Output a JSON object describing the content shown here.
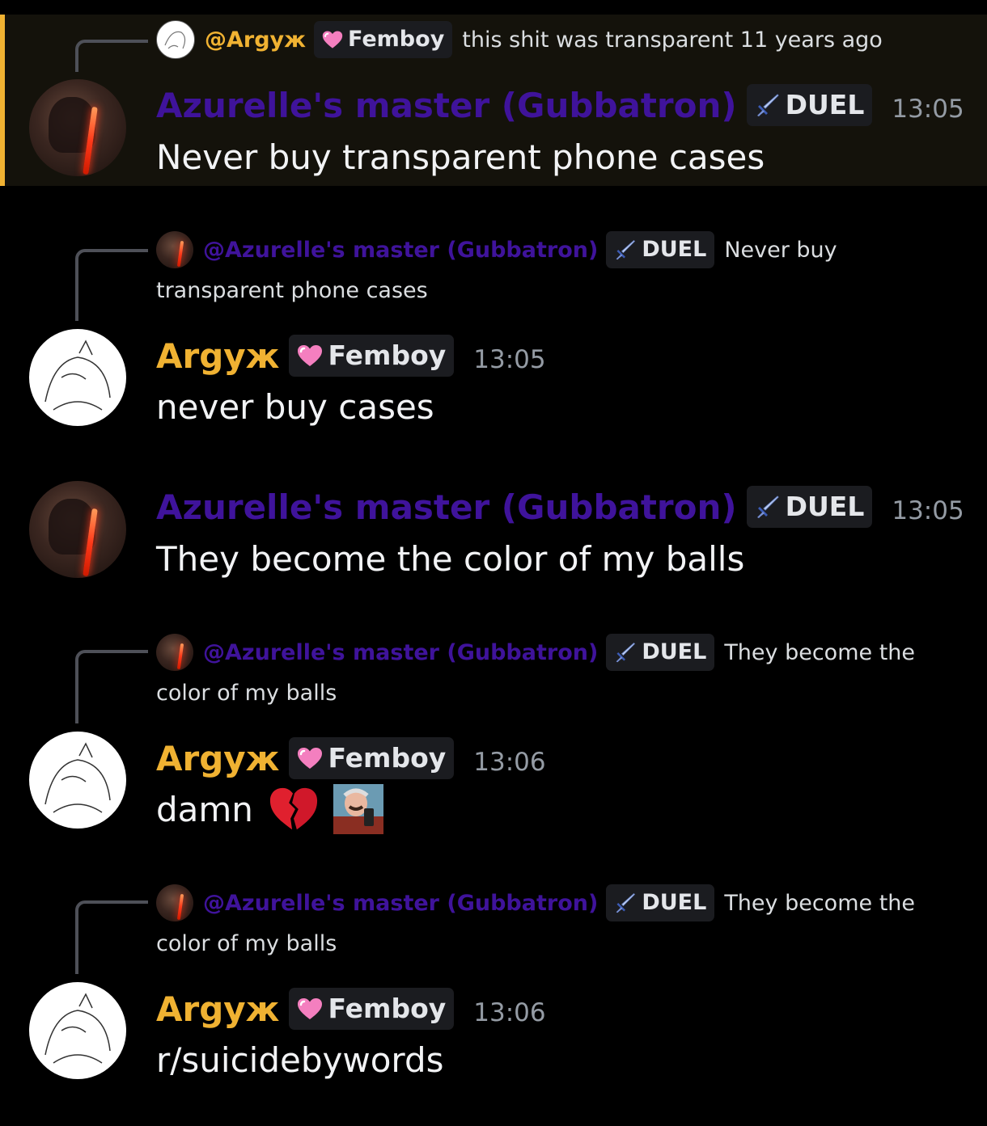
{
  "colors": {
    "azurelle_name": "#3f139b",
    "argyzh_name": "#f0b232",
    "highlight_bar": "#f0b232",
    "background": "#000000"
  },
  "messages": [
    {
      "reply": {
        "name": "@Argyж",
        "tag": "Femboy",
        "tag_icon": "pink-heart-icon",
        "text": "this shit was transparent 11 years ago"
      },
      "author": "Azurelle's master (Gubbatron)",
      "tag": "DUEL",
      "tag_icon": "sword-icon",
      "time": "13:05",
      "content": "Never buy transparent phone cases"
    },
    {
      "reply": {
        "name": "@Azurelle's master (Gubbatron)",
        "tag": "DUEL",
        "tag_icon": "sword-icon",
        "text": "Never buy transparent phone cases"
      },
      "author": "Argyж",
      "tag": "Femboy",
      "tag_icon": "pink-heart-icon",
      "time": "13:05",
      "content": "never buy cases"
    },
    {
      "author": "Azurelle's master (Gubbatron)",
      "tag": "DUEL",
      "tag_icon": "sword-icon",
      "time": "13:05",
      "content": "They become the color of my balls"
    },
    {
      "reply": {
        "name": "@Azurelle's master (Gubbatron)",
        "tag": "DUEL",
        "tag_icon": "sword-icon",
        "text": "They become the color of my balls"
      },
      "author": "Argyж",
      "tag": "Femboy",
      "tag_icon": "pink-heart-icon",
      "time": "13:06",
      "content": "damn",
      "emojis": [
        "broken-heart-emoji",
        "man-with-phone-emoji"
      ]
    },
    {
      "reply": {
        "name": "@Azurelle's master (Gubbatron)",
        "tag": "DUEL",
        "tag_icon": "sword-icon",
        "text": "They become the color of my balls"
      },
      "author": "Argyж",
      "tag": "Femboy",
      "tag_icon": "pink-heart-icon",
      "time": "13:06",
      "content": "r/suicidebywords"
    }
  ]
}
